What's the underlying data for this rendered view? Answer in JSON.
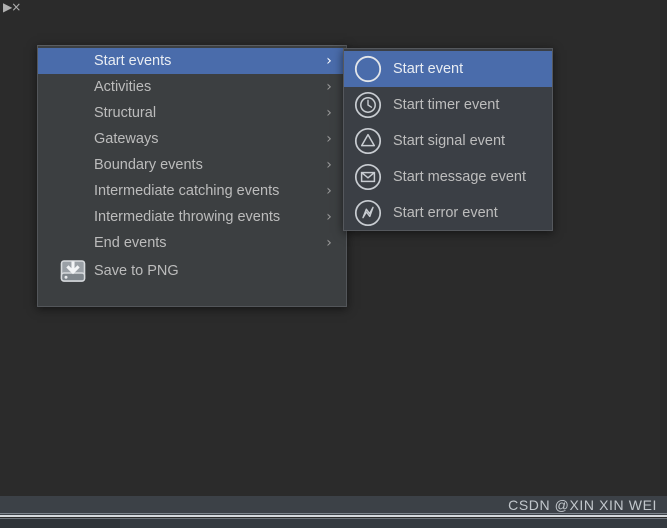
{
  "window": {
    "background_color": "#2b2b2b",
    "corner_glyph": "▶×"
  },
  "context_menu": {
    "items": [
      {
        "label": "Start events",
        "has_submenu": true,
        "selected": true,
        "chevron": "›"
      },
      {
        "label": "Activities",
        "has_submenu": true,
        "selected": false,
        "chevron": "›"
      },
      {
        "label": "Structural",
        "has_submenu": true,
        "selected": false,
        "chevron": "›"
      },
      {
        "label": "Gateways",
        "has_submenu": true,
        "selected": false,
        "chevron": "›"
      },
      {
        "label": "Boundary events",
        "has_submenu": true,
        "selected": false,
        "chevron": "›"
      },
      {
        "label": "Intermediate catching events",
        "has_submenu": true,
        "selected": false,
        "chevron": "›"
      },
      {
        "label": "Intermediate throwing events",
        "has_submenu": true,
        "selected": false,
        "chevron": "›"
      },
      {
        "label": "End events",
        "has_submenu": true,
        "selected": false,
        "chevron": "›"
      }
    ],
    "save_item": {
      "label": "Save to PNG",
      "icon": "save-to-disk-icon"
    },
    "highlight_color": "#4a6cab",
    "background_color": "#3c3f41",
    "text_color": "#bcbcbc"
  },
  "submenu": {
    "parent": "Start events",
    "items": [
      {
        "label": "Start event",
        "icon": "bpmn-start-event-icon",
        "selected": true
      },
      {
        "label": "Start timer event",
        "icon": "bpmn-start-timer-event-icon",
        "selected": false
      },
      {
        "label": "Start signal event",
        "icon": "bpmn-start-signal-event-icon",
        "selected": false
      },
      {
        "label": "Start message event",
        "icon": "bpmn-start-message-event-icon",
        "selected": false
      },
      {
        "label": "Start error event",
        "icon": "bpmn-start-error-event-icon",
        "selected": false
      }
    ],
    "background_color": "#3b3f45",
    "highlight_color": "#4a6cab"
  },
  "status_bar": {
    "watermark": "CSDN @XIN XIN WEI",
    "background_color": "#3c4147"
  }
}
